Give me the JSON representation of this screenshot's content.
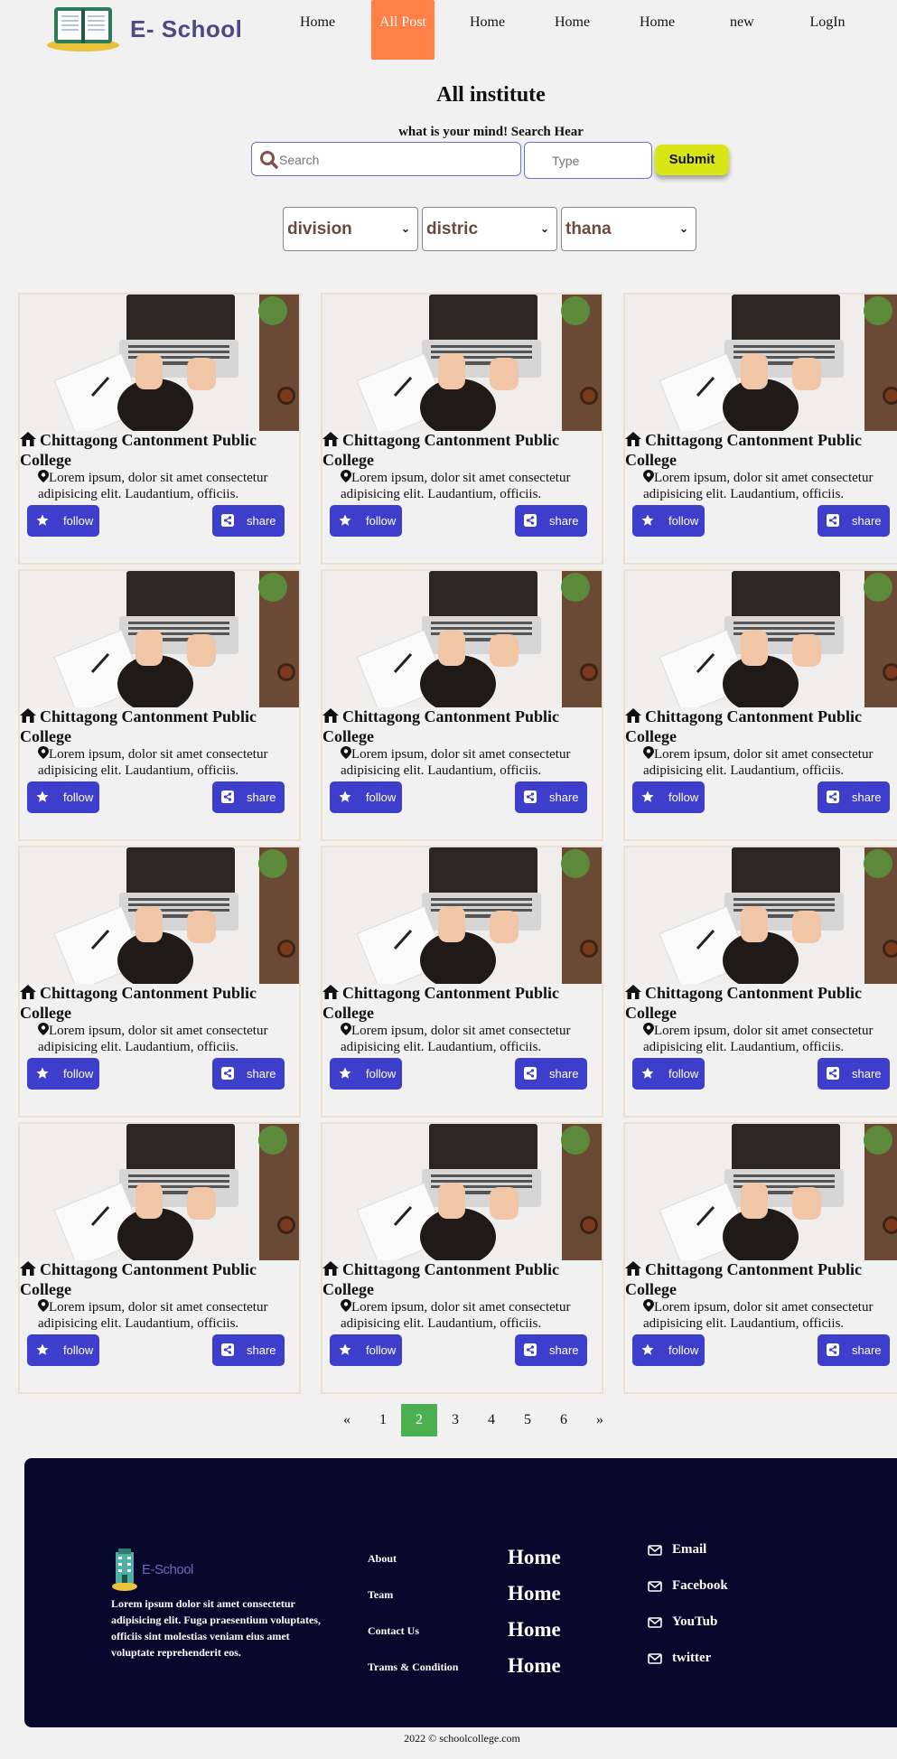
{
  "header": {
    "logo_text": "E- School",
    "nav": [
      {
        "label": "Home",
        "active": false
      },
      {
        "label": "All Post",
        "active": true
      },
      {
        "label": "Home",
        "active": false
      },
      {
        "label": "Home",
        "active": false
      },
      {
        "label": "Home",
        "active": false
      },
      {
        "label": "new",
        "active": false
      },
      {
        "label": "LogIn",
        "active": false
      }
    ]
  },
  "main": {
    "title": "All institute",
    "subtitle": "what is your mind! Search Hear",
    "search_placeholder": "Search",
    "type_placeholder": "Type",
    "submit_label": "Submit",
    "filters": [
      {
        "value": "division"
      },
      {
        "value": "distric"
      },
      {
        "value": "thana"
      }
    ]
  },
  "cards": [
    {
      "title": "Chittagong Cantonment Public College",
      "desc": "Lorem ipsum, dolor sit amet consectetur adipisicing elit. Laudantium, officiis.",
      "follow": "follow",
      "share": "share"
    },
    {
      "title": "Chittagong Cantonment Public College",
      "desc": "Lorem ipsum, dolor sit amet consectetur adipisicing elit. Laudantium, officiis.",
      "follow": "follow",
      "share": "share"
    },
    {
      "title": "Chittagong Cantonment Public College",
      "desc": "Lorem ipsum, dolor sit amet consectetur adipisicing elit. Laudantium, officiis.",
      "follow": "follow",
      "share": "share"
    },
    {
      "title": "Chittagong Cantonment Public College",
      "desc": "Lorem ipsum, dolor sit amet consectetur adipisicing elit. Laudantium, officiis.",
      "follow": "follow",
      "share": "share"
    },
    {
      "title": "Chittagong Cantonment Public College",
      "desc": "Lorem ipsum, dolor sit amet consectetur adipisicing elit. Laudantium, officiis.",
      "follow": "follow",
      "share": "share"
    },
    {
      "title": "Chittagong Cantonment Public College",
      "desc": "Lorem ipsum, dolor sit amet consectetur adipisicing elit. Laudantium, officiis.",
      "follow": "follow",
      "share": "share"
    },
    {
      "title": "Chittagong Cantonment Public College",
      "desc": "Lorem ipsum, dolor sit amet consectetur adipisicing elit. Laudantium, officiis.",
      "follow": "follow",
      "share": "share"
    },
    {
      "title": "Chittagong Cantonment Public College",
      "desc": "Lorem ipsum, dolor sit amet consectetur adipisicing elit. Laudantium, officiis.",
      "follow": "follow",
      "share": "share"
    },
    {
      "title": "Chittagong Cantonment Public College",
      "desc": "Lorem ipsum, dolor sit amet consectetur adipisicing elit. Laudantium, officiis.",
      "follow": "follow",
      "share": "share"
    },
    {
      "title": "Chittagong Cantonment Public College",
      "desc": "Lorem ipsum, dolor sit amet consectetur adipisicing elit. Laudantium, officiis.",
      "follow": "follow",
      "share": "share"
    },
    {
      "title": "Chittagong Cantonment Public College",
      "desc": "Lorem ipsum, dolor sit amet consectetur adipisicing elit. Laudantium, officiis.",
      "follow": "follow",
      "share": "share"
    },
    {
      "title": "Chittagong Cantonment Public College",
      "desc": "Lorem ipsum, dolor sit amet consectetur adipisicing elit. Laudantium, officiis.",
      "follow": "follow",
      "share": "share"
    }
  ],
  "pagination": [
    "«",
    "1",
    "2",
    "3",
    "4",
    "5",
    "6",
    "»"
  ],
  "pagination_active": "2",
  "footer": {
    "logo_text": "E-School",
    "desc": "Lorem ipsum dolor sit amet consectetur adipisicing elit. Fuga praesentium voluptates, officiis sint molestias veniam eius amet voluptate reprehenderit eos.",
    "links": [
      "About",
      "Team",
      "Contact Us",
      "Trams & Condition"
    ],
    "homes": [
      "Home",
      "Home",
      "Home",
      "Home"
    ],
    "social": [
      "Email",
      "Facebook",
      "YouTub",
      "twitter"
    ],
    "copyright": "2022 © schoolcollege.com"
  },
  "colors": {
    "accent_orange": "#ff7f44",
    "button_blue": "#3d3fcc",
    "submit_yellow": "#d9e616",
    "footer_bg": "#07072b",
    "pagination_active": "#4caf50"
  }
}
